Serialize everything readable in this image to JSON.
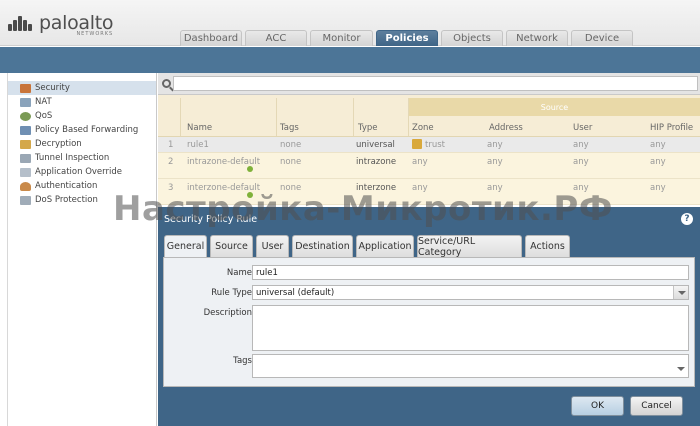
{
  "brand": {
    "name": "paloalto",
    "sub": "NETWORKS"
  },
  "nav_tabs": [
    {
      "label": "Dashboard",
      "active": false
    },
    {
      "label": "ACC",
      "active": false
    },
    {
      "label": "Monitor",
      "active": false
    },
    {
      "label": "Policies",
      "active": true
    },
    {
      "label": "Objects",
      "active": false
    },
    {
      "label": "Network",
      "active": false
    },
    {
      "label": "Device",
      "active": false
    }
  ],
  "sidebar": {
    "items": [
      {
        "label": "Security",
        "icon": "security-policy-icon",
        "selected": true
      },
      {
        "label": "NAT",
        "icon": "nat-icon",
        "selected": false
      },
      {
        "label": "QoS",
        "icon": "qos-icon",
        "selected": false
      },
      {
        "label": "Policy Based Forwarding",
        "icon": "pbf-icon",
        "selected": false
      },
      {
        "label": "Decryption",
        "icon": "decryption-icon",
        "selected": false
      },
      {
        "label": "Tunnel Inspection",
        "icon": "tunnel-icon",
        "selected": false
      },
      {
        "label": "Application Override",
        "icon": "app-override-icon",
        "selected": false
      },
      {
        "label": "Authentication",
        "icon": "authentication-icon",
        "selected": false
      },
      {
        "label": "DoS Protection",
        "icon": "dos-icon",
        "selected": false
      }
    ]
  },
  "grid": {
    "source_group": "Source",
    "columns": [
      "Name",
      "Tags",
      "Type",
      "Zone",
      "Address",
      "User",
      "HIP Profile"
    ],
    "rows": [
      {
        "num": "1",
        "name": "rule1",
        "tags": "none",
        "type": "universal",
        "zone": "trust",
        "address": "any",
        "user": "any",
        "hip": "any"
      },
      {
        "num": "2",
        "name": "intrazone-default",
        "tags": "none",
        "type": "intrazone",
        "zone": "any",
        "address": "any",
        "user": "any",
        "hip": "any"
      },
      {
        "num": "3",
        "name": "interzone-default",
        "tags": "none",
        "type": "interzone",
        "zone": "any",
        "address": "any",
        "user": "any",
        "hip": "any"
      }
    ]
  },
  "dialog": {
    "title": "Security Policy Rule",
    "help": "?",
    "tabs": [
      {
        "label": "General",
        "active": true
      },
      {
        "label": "Source",
        "active": false
      },
      {
        "label": "User",
        "active": false
      },
      {
        "label": "Destination",
        "active": false
      },
      {
        "label": "Application",
        "active": false
      },
      {
        "label": "Service/URL Category",
        "active": false
      },
      {
        "label": "Actions",
        "active": false
      }
    ],
    "fields": {
      "name_label": "Name",
      "name_value": "rule1",
      "rule_type_label": "Rule Type",
      "rule_type_value": "universal (default)",
      "description_label": "Description",
      "description_value": "",
      "tags_label": "Tags",
      "tags_value": ""
    },
    "ok_label": "OK",
    "cancel_label": "Cancel"
  },
  "watermark": "Настройка-Микротик.РФ"
}
